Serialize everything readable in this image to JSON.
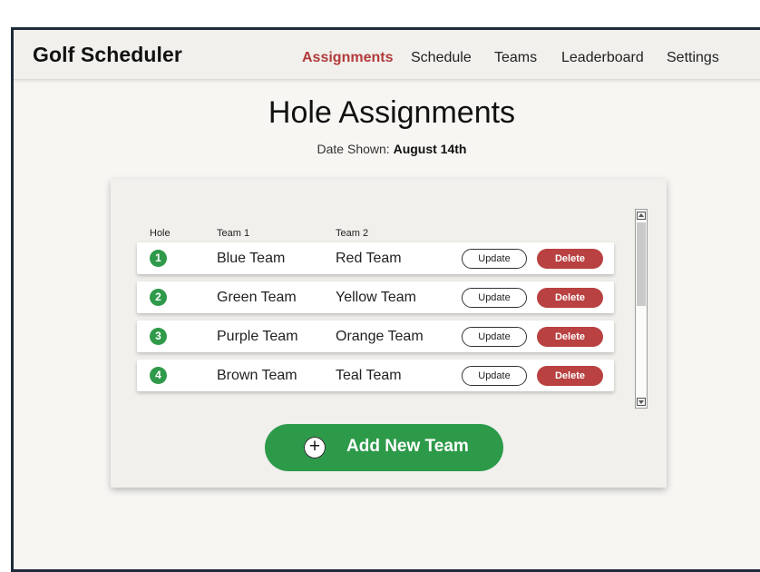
{
  "header": {
    "app_title": "Golf Scheduler",
    "nav": [
      {
        "label": "Assignments",
        "active": true
      },
      {
        "label": "Schedule",
        "active": false
      },
      {
        "label": "Teams",
        "active": false
      },
      {
        "label": "Leaderboard",
        "active": false
      },
      {
        "label": "Settings",
        "active": false
      }
    ]
  },
  "main": {
    "title": "Hole Assignments",
    "date_label": "Date Shown:",
    "date_value": "August 14th"
  },
  "table": {
    "columns": [
      "Hole",
      "Team 1",
      "Team 2"
    ],
    "rows": [
      {
        "hole": "1",
        "team1": "Blue Team",
        "team2": "Red Team"
      },
      {
        "hole": "2",
        "team1": "Green Team",
        "team2": "Yellow Team"
      },
      {
        "hole": "3",
        "team1": "Purple Team",
        "team2": "Orange Team"
      },
      {
        "hole": "4",
        "team1": "Brown Team",
        "team2": "Teal Team"
      }
    ],
    "update_label": "Update",
    "delete_label": "Delete"
  },
  "actions": {
    "add_label": "Add New Team",
    "add_icon": "plus-circle-icon",
    "add_glyph": "+"
  },
  "colors": {
    "accent_red": "#b23a3a",
    "delete_red": "#b94141",
    "green": "#2d9a4a"
  }
}
